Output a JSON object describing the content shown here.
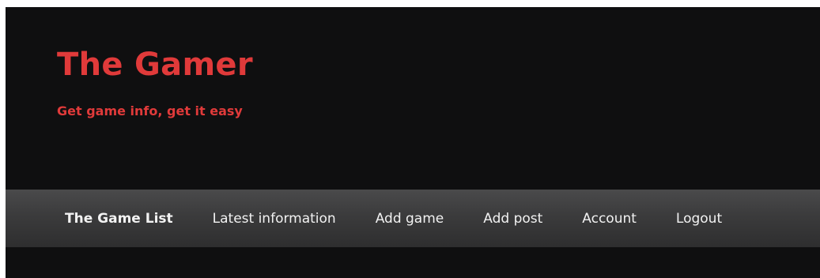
{
  "site": {
    "title": "The Gamer",
    "tagline": "Get game info, get it easy"
  },
  "nav": {
    "items": [
      {
        "label": "The Game List",
        "active": true
      },
      {
        "label": "Latest information",
        "active": false
      },
      {
        "label": "Add game",
        "active": false
      },
      {
        "label": "Add post",
        "active": false
      },
      {
        "label": "Account",
        "active": false
      },
      {
        "label": "Logout",
        "active": false
      }
    ]
  },
  "colors": {
    "background": "#0f0f10",
    "accent": "#e03a3a",
    "nav_bar": "#3b3b3c",
    "nav_text": "#f2f2f2"
  }
}
